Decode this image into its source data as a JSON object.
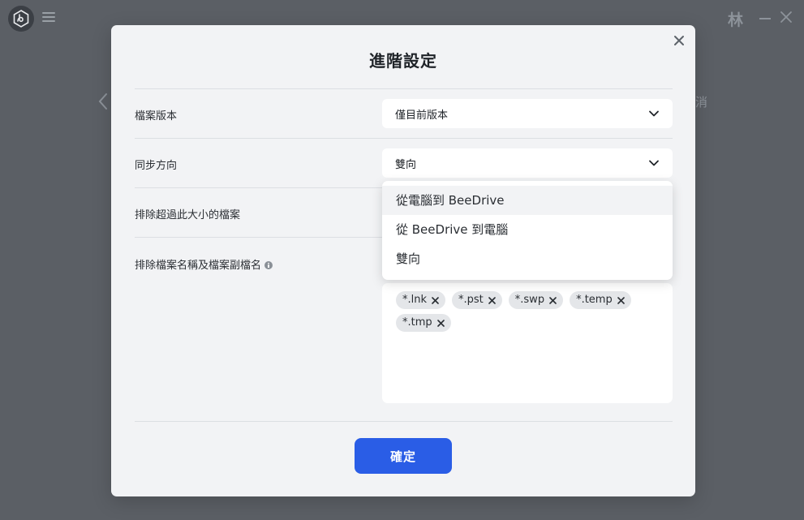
{
  "app": {
    "avatar_initial": "林",
    "background_cancel_text": "消"
  },
  "dialog": {
    "title": "進階設定",
    "rows": {
      "file_version": {
        "label": "檔案版本",
        "value": "僅目前版本"
      },
      "sync_direction": {
        "label": "同步方向",
        "value": "雙向"
      },
      "exclude_size": {
        "label": "排除超過此大小的檔案"
      },
      "exclude_names": {
        "label": "排除檔案名稱及檔案副檔名"
      }
    },
    "sync_direction_options": [
      {
        "label": "從電腦到 BeeDrive"
      },
      {
        "label": "從 BeeDrive 到電腦"
      },
      {
        "label": "雙向"
      }
    ],
    "excluded_patterns": [
      "*.lnk",
      "*.pst",
      "*.swp",
      "*.temp",
      "*.tmp"
    ],
    "confirm_label": "確定"
  },
  "colors": {
    "overlay": "#5b5f65",
    "dialog_bg": "#f2f3f5",
    "accent": "#2a5de6"
  }
}
